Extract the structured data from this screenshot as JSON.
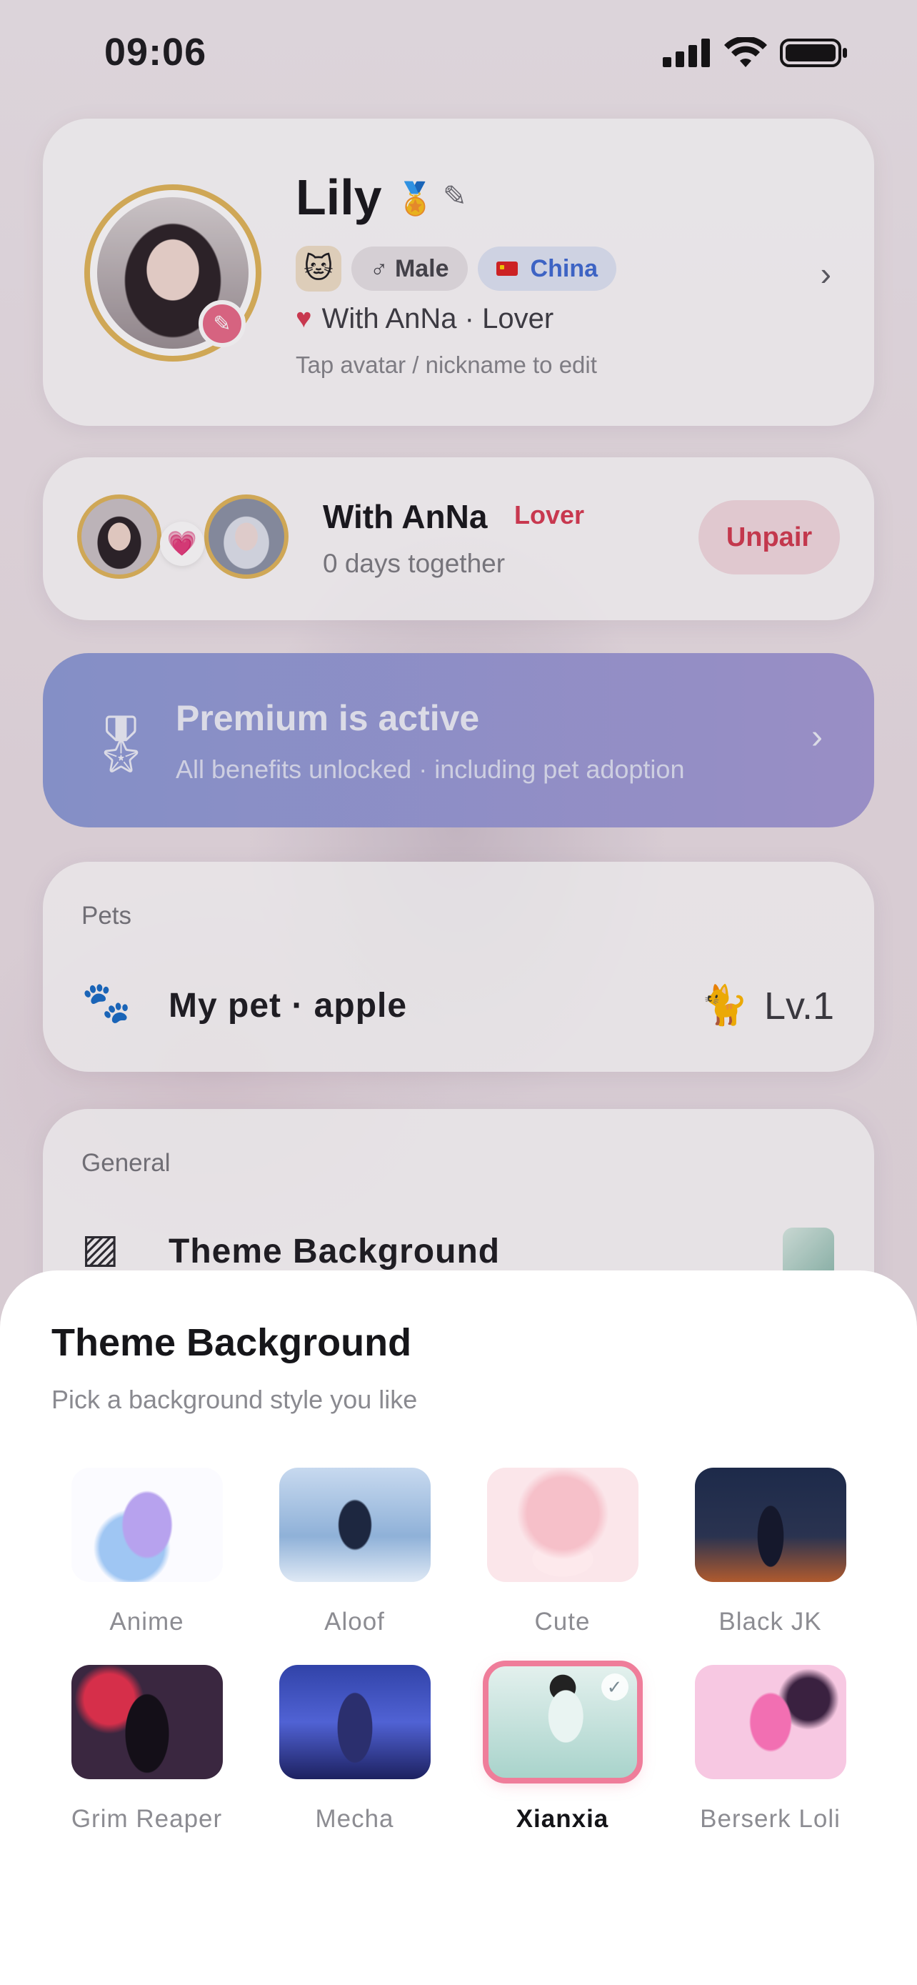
{
  "status_bar": {
    "time": "09:06"
  },
  "profile": {
    "name": "Lily",
    "gender": "♂ Male",
    "country": "China",
    "relationship_line": "With AnNa · Lover",
    "edit_hint": "Tap avatar / nickname to edit"
  },
  "pair": {
    "title": "With AnNa",
    "badge": "Lover",
    "days": "0 days together",
    "unpair_label": "Unpair"
  },
  "premium": {
    "title": "Premium is active",
    "subtitle": "All benefits unlocked · including pet adoption"
  },
  "pets": {
    "section": "Pets",
    "row_label": "My pet · apple",
    "level": "Lv.1"
  },
  "general": {
    "section": "General",
    "row_label": "Theme Background"
  },
  "sheet": {
    "title": "Theme Background",
    "subtitle": "Pick a background style you like",
    "themes": [
      {
        "label": "Anime"
      },
      {
        "label": "Aloof"
      },
      {
        "label": "Cute"
      },
      {
        "label": "Black JK"
      },
      {
        "label": "Grim Reaper"
      },
      {
        "label": "Mecha"
      },
      {
        "label": "Xianxia",
        "selected": true
      },
      {
        "label": "Berserk Loli"
      }
    ]
  },
  "colors": {
    "accent_pink": "#ef7d9a",
    "lover_red": "#d93a52",
    "premium_start": "#8d9bd6",
    "premium_end": "#a49ad5"
  }
}
